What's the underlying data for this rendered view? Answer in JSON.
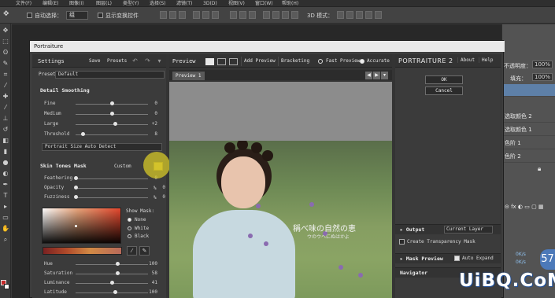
{
  "ps": {
    "menus": [
      "文件(F)",
      "编辑(E)",
      "图像(I)",
      "图层(L)",
      "类型(Y)",
      "选择(S)",
      "滤镜(T)",
      "3D(D)",
      "视图(V)",
      "窗口(W)",
      "帮助(H)"
    ],
    "options": {
      "auto_select_label": "自动选择：",
      "auto_select_value": "组",
      "transform_label": "显示变换控件",
      "mode_3d_label": "3D 模式："
    },
    "right_panel": {
      "opacity_label": "不透明度：",
      "opacity_value": "100%",
      "fill_label": "填充：",
      "fill_value": "100%",
      "layers": [
        "选取颜色 2",
        "选取颜色 1",
        "色阶 1",
        "色阶 2"
      ]
    },
    "badge_number": "57",
    "speed_up": "0K/s",
    "speed_down": "0K/s"
  },
  "dialog": {
    "title": "Portraiture",
    "settings": {
      "title": "Settings",
      "save": "Save",
      "presets": "Presets",
      "preset_label": "Preset",
      "preset_value": "Default",
      "detail_smoothing": "Detail Smoothing",
      "sliders": [
        {
          "name": "Fine",
          "value": "0",
          "frac": 0.5
        },
        {
          "name": "Medium",
          "value": "0",
          "frac": 0.5
        },
        {
          "name": "Large",
          "value": "+2",
          "frac": 0.55
        },
        {
          "name": "Threshold",
          "value": "8",
          "frac": 0.1
        }
      ],
      "portrait_size": "Portrait Size Auto Detect",
      "skin_tones_mask": "Skin Tones Mask",
      "mask_mode": "Custom",
      "mask_sliders": [
        {
          "name": "Feathering",
          "value": "0",
          "unit": "",
          "frac": 0.0
        },
        {
          "name": "Opacity",
          "value": "0",
          "unit": "%",
          "frac": 0.0
        },
        {
          "name": "Fuzziness",
          "value": "0",
          "unit": "%",
          "frac": 0.0
        }
      ],
      "show_mask_label": "Show Mask:",
      "show_mask_options": [
        "None",
        "White",
        "Black"
      ],
      "show_mask_selected": 0,
      "tone_sliders": [
        {
          "name": "Hue",
          "value": "100",
          "frac": 0.58
        },
        {
          "name": "Saturation",
          "value": "58",
          "frac": 0.58
        },
        {
          "name": "Luminance",
          "value": "41",
          "frac": 0.5
        },
        {
          "name": "Latitude",
          "value": "100",
          "frac": 0.55
        }
      ]
    },
    "preview": {
      "title": "Preview",
      "add_preview": "Add Preview",
      "bracketing": "Bracketing",
      "fast_preview": "Fast Preview",
      "accurate": "Accurate",
      "tab": "Preview 1",
      "photo_text": "稱べ味の自然の恵",
      "photo_subtext": "ウのウヘにぬはかよ"
    },
    "product": {
      "brand": "PORTRAITURE 2",
      "about": "About",
      "help": "Help",
      "ok": "OK",
      "cancel": "Cancel",
      "output_label": "Output",
      "output_value": "Current Layer",
      "create_transparency_mask": "Create Transparency Mask",
      "mask_preview": "Mask Preview",
      "auto_expand": "Auto Expand",
      "navigator": "Navigator"
    }
  },
  "watermark": "UiBQ.CoM"
}
